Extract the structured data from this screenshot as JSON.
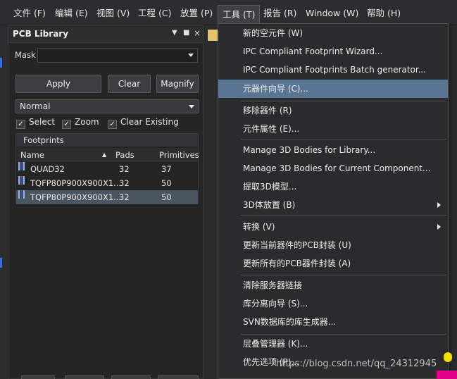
{
  "menubar": {
    "items": [
      "文件 (F)",
      "编辑 (E)",
      "视图 (V)",
      "工程 (C)",
      "放置 (P)",
      "工具 (T)",
      "报告 (R)",
      "Window (W)",
      "帮助 (H)"
    ]
  },
  "panel": {
    "title": "PCB Library",
    "mask_label": "Mask",
    "mask_value": "",
    "apply_label": "Apply",
    "clear_label": "Clear",
    "magnify_label": "Magnify",
    "mode_value": "Normal",
    "checkboxes": [
      {
        "label": "Select",
        "checked": true
      },
      {
        "label": "Zoom",
        "checked": true
      },
      {
        "label": "Clear Existing",
        "checked": true
      }
    ],
    "footprints": {
      "title": "Footprints",
      "columns": [
        "Name",
        "Pads",
        "Primitives"
      ],
      "rows": [
        {
          "name": "QUAD32",
          "pads": "32",
          "primitives": "37",
          "selected": false
        },
        {
          "name": "TQFP80P900X900X1...",
          "pads": "32",
          "primitives": "50",
          "selected": false
        },
        {
          "name": "TQFP80P900X900X1...",
          "pads": "32",
          "primitives": "50",
          "selected": true
        }
      ]
    }
  },
  "tools_menu": {
    "items": [
      "新的空元件 (W)",
      "IPC Compliant Footprint Wizard...",
      "IPC Compliant Footprints Batch generator...",
      "元器件向导 (C)...",
      "移除器件 (R)",
      "元件属性 (E)...",
      "Manage 3D Bodies for Library...",
      "Manage 3D Bodies for Current Component...",
      "提取3D模型...",
      "3D体放置 (B)",
      "转换 (V)",
      "更新当前器件的PCB封装 (U)",
      "更新所有的PCB器件封装 (A)",
      "清除服务器链接",
      "库分离向导 (S)...",
      "SVN数据库的库生成器...",
      "层叠管理器 (K)...",
      "优先选项 (P)..."
    ]
  },
  "watermark": "https://blog.csdn.net/qq_24312945",
  "colors": {
    "menu_highlight": "#5a7594",
    "selected_row": "#4a5560",
    "background": "#2b2b2b"
  }
}
